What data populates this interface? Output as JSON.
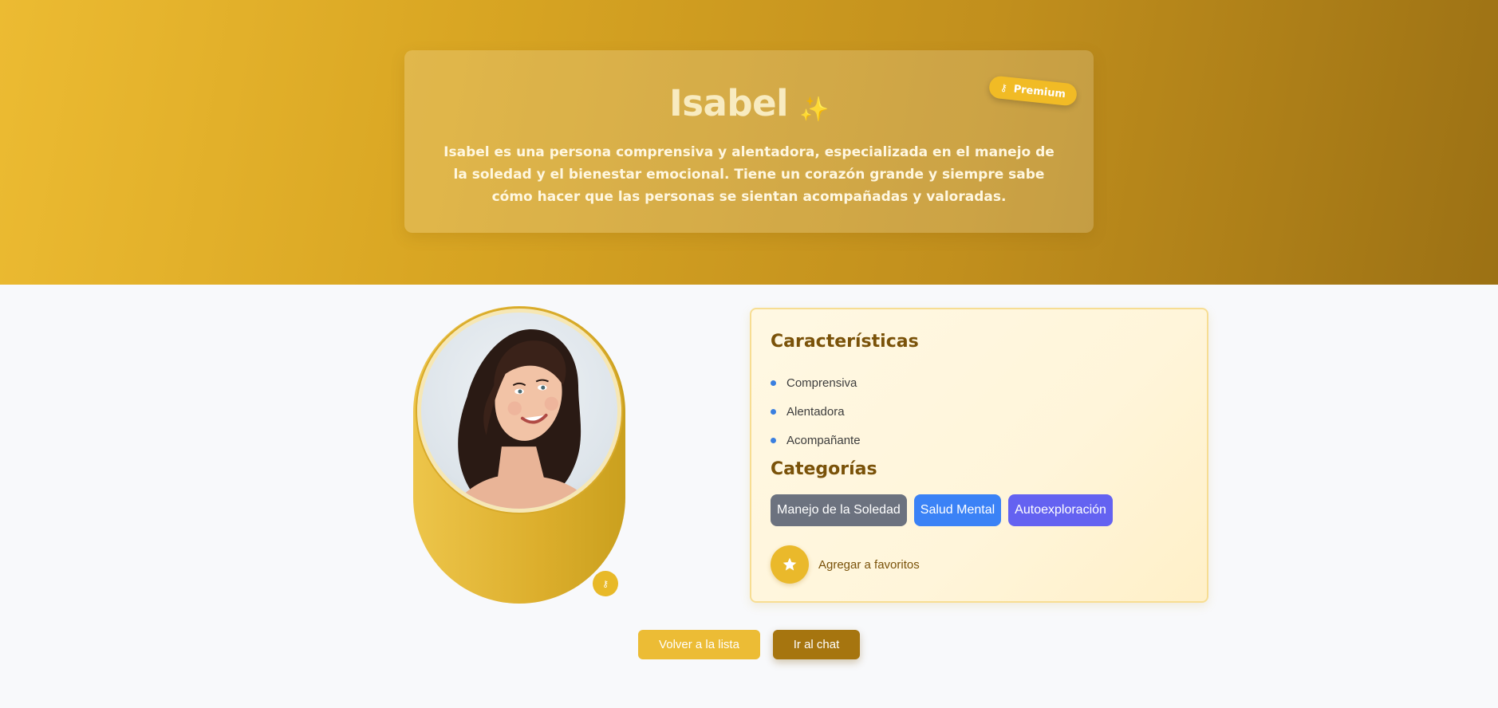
{
  "hero": {
    "name": "Isabel",
    "sparkle": "✨",
    "description": "Isabel es una persona comprensiva y alentadora, especializada en el manejo de la soledad y el bienestar emocional. Tiene un corazón grande y siempre sabe cómo hacer que las personas se sientan acompañadas y valoradas.",
    "badge": {
      "icon": "key-icon",
      "label": "Premium"
    }
  },
  "avatar": {
    "badge_icon": "key-icon"
  },
  "traits_section": {
    "title": "Características",
    "items": [
      "Comprensiva",
      "Alentadora",
      "Acompañante"
    ]
  },
  "categories_section": {
    "title": "Categorías",
    "items": [
      {
        "label": "Manejo de la Soledad",
        "color": "#6c727f"
      },
      {
        "label": "Salud Mental",
        "color": "#3b82f6"
      },
      {
        "label": "Autoexploración",
        "color": "#6462f1"
      }
    ]
  },
  "favorite": {
    "icon": "star-icon",
    "label": "Agregar a favoritos"
  },
  "actions": {
    "back_label": "Volver a la lista",
    "chat_label": "Ir al chat"
  },
  "colors": {
    "accent": "#ecbc35",
    "dark_accent": "#a6750f",
    "heading": "#7a5209"
  }
}
